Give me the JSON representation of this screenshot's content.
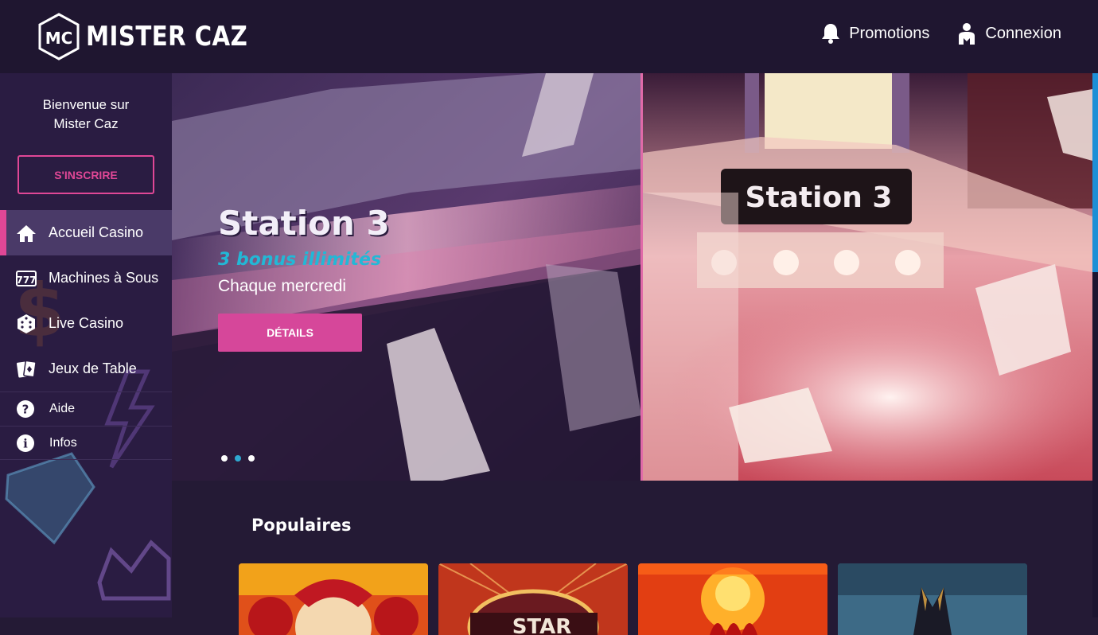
{
  "brand": {
    "logo_text": "MISTER CAZ",
    "logo_monogram": "MC"
  },
  "topnav": {
    "promotions": {
      "label": "Promotions",
      "icon": "bell-icon"
    },
    "connexion": {
      "label": "Connexion",
      "icon": "user-icon"
    }
  },
  "sidebar": {
    "welcome": "Bienvenue sur\nMister Caz",
    "signup_label": "S'INSCRIRE",
    "items": [
      {
        "label": "Accueil Casino",
        "icon": "home-icon",
        "active": true
      },
      {
        "label": "Machines à Sous",
        "icon": "slot-machine-icon",
        "active": false
      },
      {
        "label": "Live Casino",
        "icon": "dice-icon",
        "active": false
      },
      {
        "label": "Jeux de Table",
        "icon": "cards-icon",
        "active": false
      },
      {
        "label": "Aide",
        "icon": "question-icon",
        "active": false
      },
      {
        "label": "Infos",
        "icon": "info-icon",
        "active": false
      }
    ]
  },
  "hero": {
    "title": "Station 3",
    "subtitle": "3 bonus illimités",
    "description": "Chaque mercredi",
    "button_label": "DÉTAILS",
    "sign_text": "Station 3",
    "slides_total": 3,
    "active_slide": 2
  },
  "popular": {
    "title": "Populaires",
    "games": [
      {
        "name": "game-tile-1",
        "color": "#e0501a"
      },
      {
        "name": "game-tile-2",
        "color": "#c0361c"
      },
      {
        "name": "game-tile-3",
        "color": "#e23e12"
      },
      {
        "name": "game-tile-4",
        "color": "#3d6a86"
      }
    ]
  },
  "colors": {
    "accent": "#e04796",
    "highlight": "#22b8d6",
    "bg": "#241a35",
    "header": "#1f1630"
  }
}
